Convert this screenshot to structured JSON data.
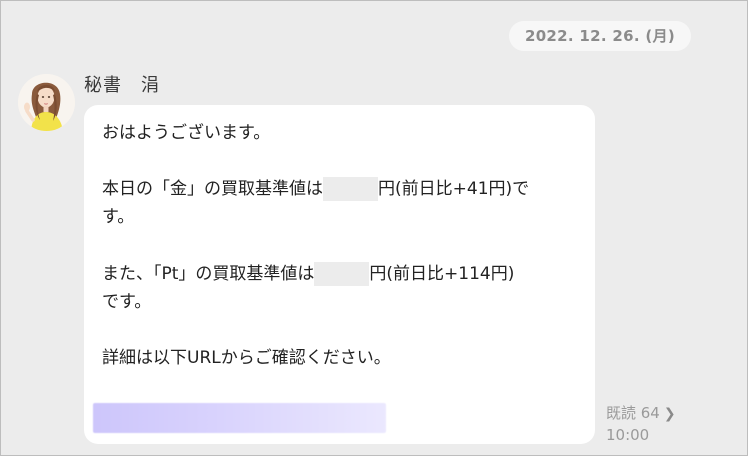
{
  "date_separator": "2022. 12. 26. (月)",
  "message": {
    "sender_name": "秘書　涓",
    "avatar_icon": "illustrated-woman-avatar",
    "lines": {
      "greeting": "おはようございます。",
      "gold_prefix": "本日の「金」の買取基準値は",
      "gold_suffix": "円(前日比+41円)で",
      "gold_wrap": "す。",
      "pt_prefix": "また、「Pt」の買取基準値は",
      "pt_suffix": "円(前日比+114円)",
      "pt_wrap": "です。",
      "details": "詳細は以下URLからご確認ください。"
    },
    "read_label": "既読 64",
    "time": "10:00"
  },
  "colors": {
    "background": "#ececec",
    "bubble": "#ffffff",
    "date_pill": "#f7f7f7",
    "link_blur": "#d4cdfc",
    "muted_text": "#9a9a9a"
  }
}
